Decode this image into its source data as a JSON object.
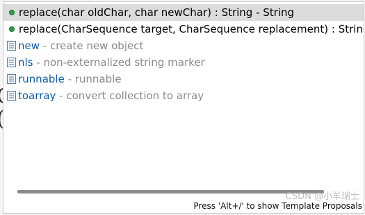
{
  "popup": {
    "items": [
      {
        "kind": "method",
        "text": "replace(char oldChar, char newChar) : String - String",
        "selected": true
      },
      {
        "kind": "method",
        "text": "replace(CharSequence target, CharSequence replacement) : String - S"
      },
      {
        "kind": "template",
        "name": "new",
        "sep": " - ",
        "desc": "create new object"
      },
      {
        "kind": "template",
        "name": "nls",
        "sep": " - ",
        "desc": "non-externalized string marker"
      },
      {
        "kind": "template",
        "name": "runnable",
        "sep": " - ",
        "desc": "runnable"
      },
      {
        "kind": "template",
        "name": "toarray",
        "sep": " - ",
        "desc": "convert collection to array"
      }
    ],
    "status_hint": "Press 'Alt+/' to show Template Proposals"
  },
  "watermark": "CSDN @小羊瑞士",
  "background_glyphs": [
    "C",
    "("
  ],
  "colors": {
    "method_icon": "#2f9e46",
    "template_keyword": "#0b5aa8",
    "description": "#8a8a8a",
    "selection": "#dcdcdc"
  },
  "icons": {
    "method": "public-method-icon",
    "template": "template-icon"
  }
}
